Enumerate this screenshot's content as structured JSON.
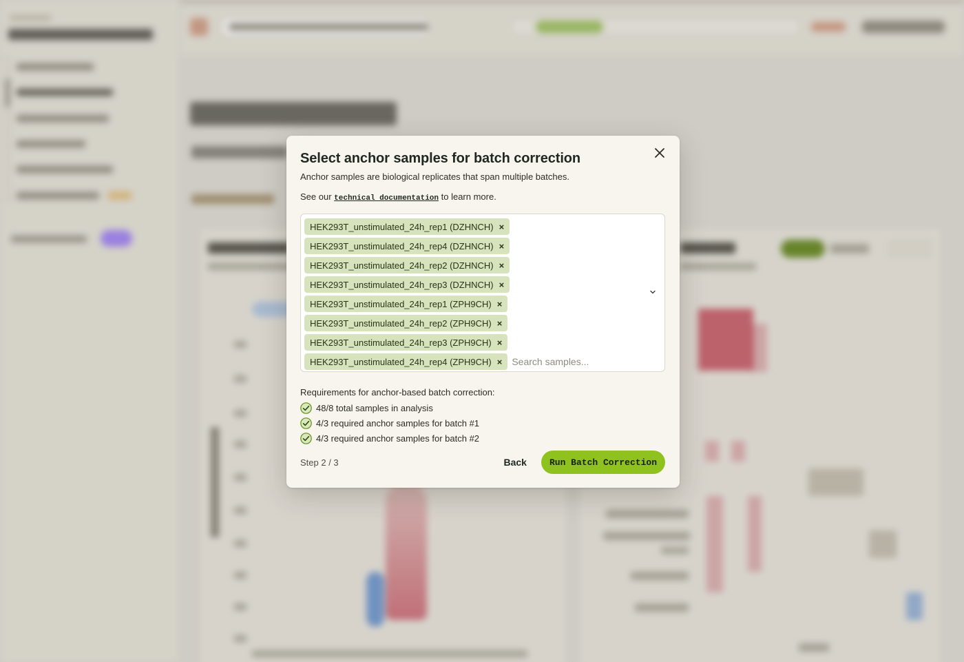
{
  "modal": {
    "title": "Select anchor samples for batch correction",
    "description": "Anchor samples are biological replicates that span multiple batches.",
    "doc_prefix": "See our",
    "doc_link": "technical documentation",
    "doc_suffix": "to learn more.",
    "selected_samples": [
      "HEK293T_unstimulated_24h_rep1 (DZHNCH)",
      "HEK293T_unstimulated_24h_rep4 (DZHNCH)",
      "HEK293T_unstimulated_24h_rep2 (DZHNCH)",
      "HEK293T_unstimulated_24h_rep3 (DZHNCH)",
      "HEK293T_unstimulated_24h_rep1 (ZPH9CH)",
      "HEK293T_unstimulated_24h_rep2 (ZPH9CH)",
      "HEK293T_unstimulated_24h_rep3 (ZPH9CH)",
      "HEK293T_unstimulated_24h_rep4 (ZPH9CH)"
    ],
    "remove_glyph": "×",
    "search": {
      "placeholder": "Search samples...",
      "value": ""
    },
    "requirements": {
      "title": "Requirements for anchor-based batch correction:",
      "items": [
        {
          "label": "48/8 total samples in analysis",
          "met": true
        },
        {
          "label": "4/3 required anchor samples for batch #1",
          "met": true
        },
        {
          "label": "4/3 required anchor samples for batch #2",
          "met": true
        }
      ]
    },
    "step": "Step 2 / 3",
    "back_label": "Back",
    "primary_label": "Run Batch Correction"
  },
  "icons": {
    "close": "close-icon",
    "remove": "remove-icon",
    "dropdown": "chevron-down-icon",
    "check": "check-circle-icon"
  },
  "colors": {
    "chip_bg": "#d7e3bd",
    "primary_button": "#8fc21e",
    "check_green": "#5f8f13",
    "modal_bg": "#f8f5ef"
  }
}
